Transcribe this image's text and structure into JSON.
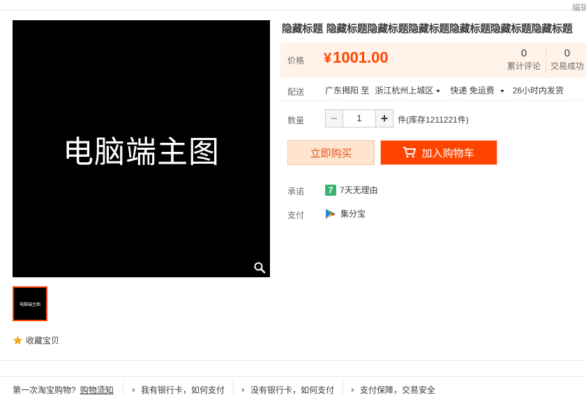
{
  "header": {
    "edit_label": "编辑"
  },
  "gallery": {
    "main_image_text": "电脑端主图",
    "thumb_text": "电脑端主图",
    "favorite_label": "收藏宝贝"
  },
  "product": {
    "title": "隐藏标题 隐藏标题隐藏标题隐藏标题隐藏标题隐藏标题隐藏标题",
    "price_label": "价格",
    "currency": "¥",
    "price": "1001.00",
    "reviews_count": "0",
    "reviews_label": "累计评论",
    "sales_count": "0",
    "sales_label": "交易成功"
  },
  "shipping": {
    "label": "配送",
    "from": "广东揭阳 至",
    "to": "浙江杭州上城区",
    "method": "快递 免运费",
    "dispatch": "26小时内发货"
  },
  "quantity": {
    "label": "数量",
    "minus": "−",
    "value": "1",
    "plus": "+",
    "stock_text": "件(库存1211221件)"
  },
  "actions": {
    "buy_now": "立即购买",
    "add_to_cart": "加入购物车"
  },
  "service": {
    "promise_label": "承诺",
    "promise_icon_text": "7",
    "promise_text": "7天无理由",
    "pay_label": "支付",
    "pay_text": "集分宝"
  },
  "footer": {
    "first_time": "第一次淘宝购物?",
    "guide_link": "购物须知",
    "have_card": "我有银行卡，如何支付",
    "no_card": "没有银行卡，如何支付",
    "guarantee": "支付保障，交易安全"
  },
  "colors": {
    "accent": "#ff4400",
    "price_bg": "#fff2e8",
    "buy_bg": "#ffe4d0"
  }
}
